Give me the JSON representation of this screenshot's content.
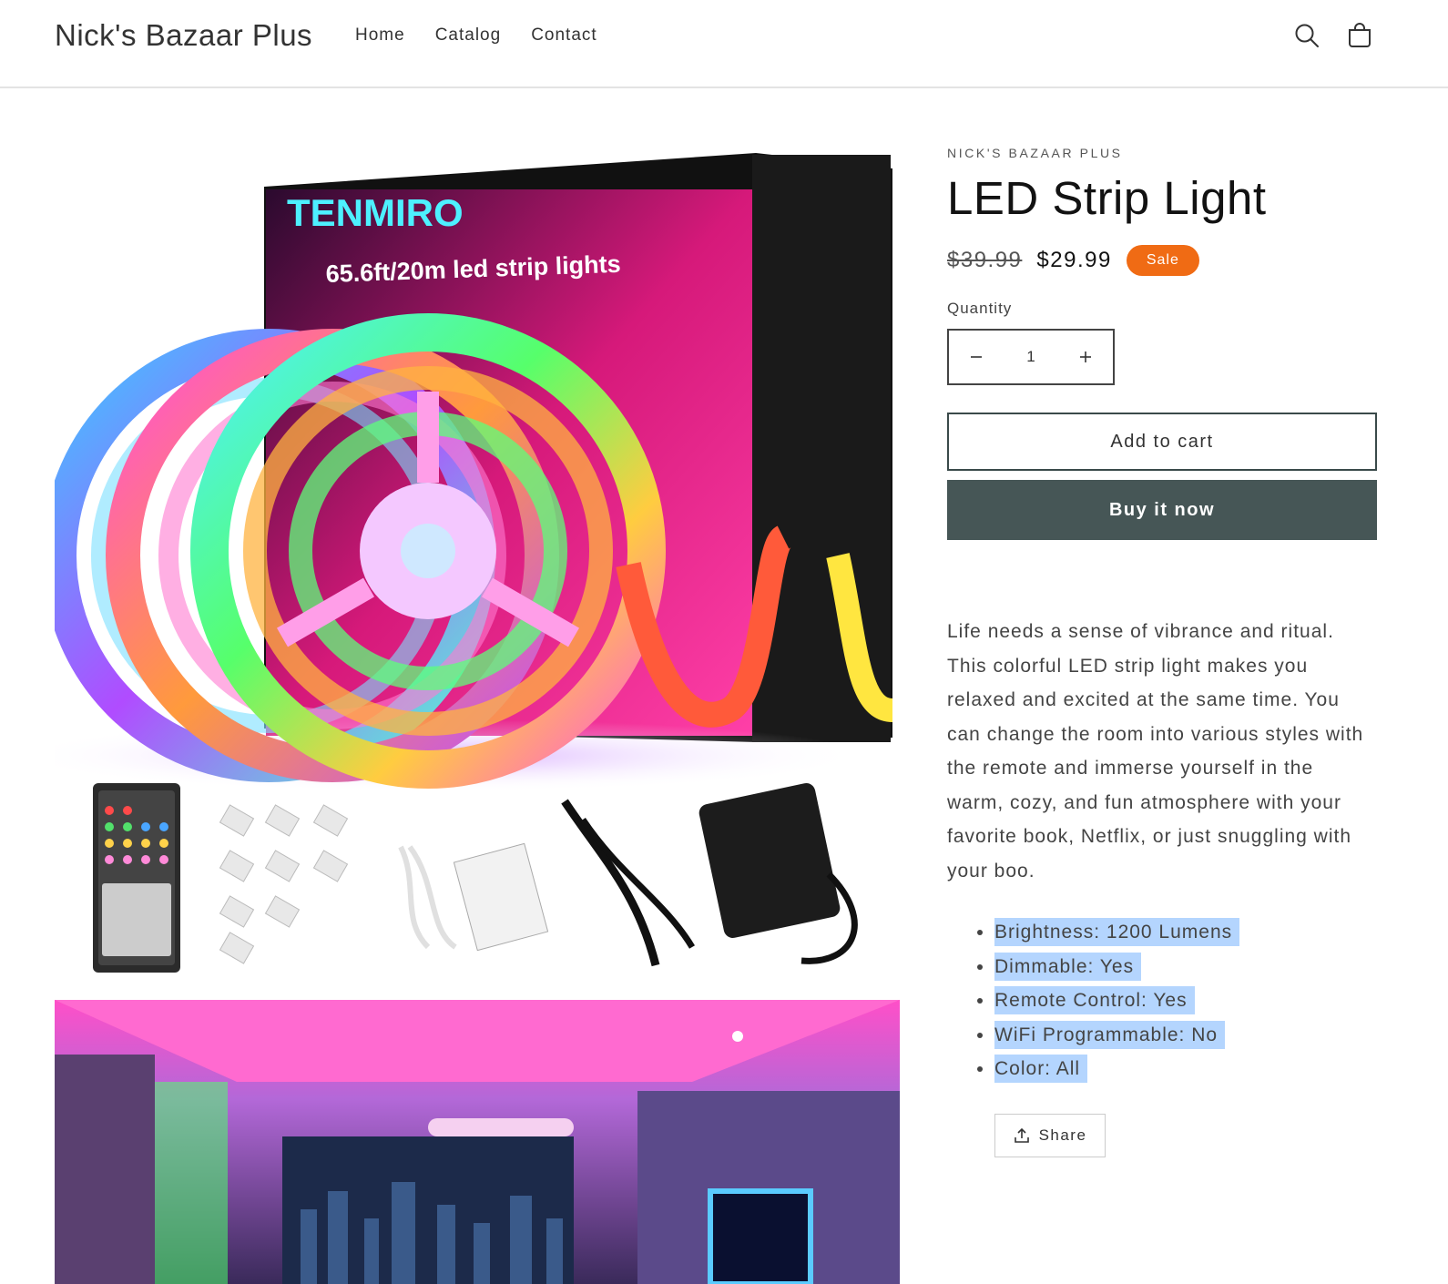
{
  "header": {
    "store_name": "Nick's Bazaar Plus",
    "nav": [
      {
        "label": "Home"
      },
      {
        "label": "Catalog"
      },
      {
        "label": "Contact"
      }
    ],
    "icons": [
      "search-icon",
      "cart-icon"
    ]
  },
  "gallery": {
    "image_1": {
      "box_brand": "TENMIRO",
      "box_caption": "65.6ft/20m led strip lights"
    }
  },
  "product": {
    "vendor": "NICK'S BAZAAR PLUS",
    "title": "LED Strip Light",
    "price_compare": "$39.99",
    "price": "$29.99",
    "badge": "Sale",
    "quantity_label": "Quantity",
    "quantity_value": "1",
    "add_to_cart": "Add to cart",
    "buy_now": "Buy it now",
    "description": "Life needs a sense of vibrance and ritual. This colorful LED strip light makes you relaxed and excited at the same time. You can change the room into various styles with the remote and immerse yourself in the warm, cozy, and fun atmosphere with your favorite book, Netflix, or just snuggling with your boo.",
    "specs": [
      "Brightness: 1200 Lumens",
      "Dimmable: Yes",
      "Remote Control: Yes",
      "WiFi Programmable: No",
      "Color: All"
    ],
    "share": "Share"
  },
  "colors": {
    "sale_badge": "#f06b14",
    "buy_button": "#465656",
    "selection_highlight": "#b4d5fe"
  }
}
